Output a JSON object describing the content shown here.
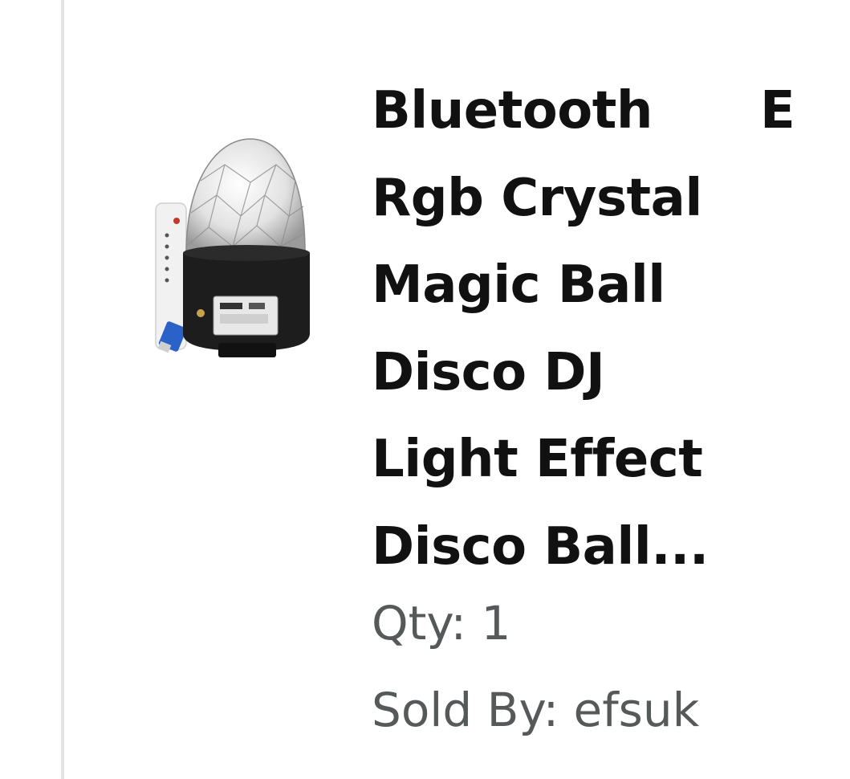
{
  "item": {
    "title": "Bluetooth Rgb Crystal Magic Ball Disco DJ Light Effect Disco Ball...",
    "quantity_text": "Qty: 1",
    "sold_by_text": "Sold By: efsuk",
    "image_icon": "disco-ball-product-photo"
  },
  "next_column": {
    "title_fragment": "E"
  },
  "colors": {
    "title": "#111111",
    "secondary_text": "#565959",
    "divider": "#e3e3e3"
  }
}
